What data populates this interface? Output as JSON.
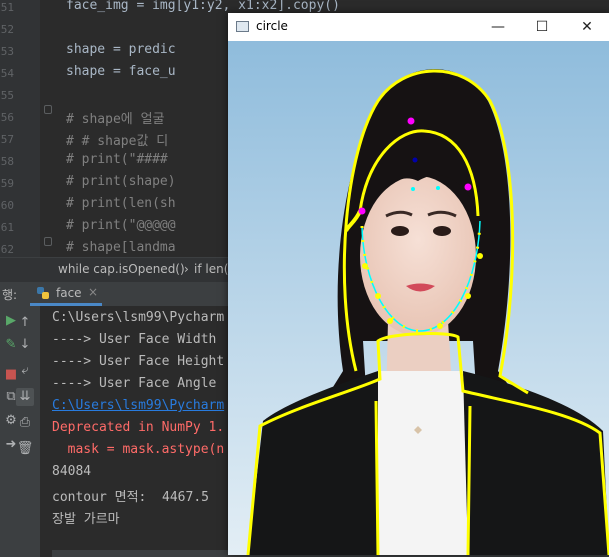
{
  "editor": {
    "line_numbers": [
      "51",
      "52",
      "53",
      "54",
      "55",
      "56",
      "57",
      "58",
      "59",
      "60",
      "61",
      "62"
    ],
    "lines": [
      {
        "text": "face_img = img[y1:y2, x1:x2].copy()",
        "comment": false
      },
      {
        "text": "",
        "comment": false
      },
      {
        "text": "shape = predic",
        "comment": false
      },
      {
        "text": "shape = face_u",
        "comment": false
      },
      {
        "text": "",
        "comment": false
      },
      {
        "text": "# shape에 얼굴",
        "comment": true
      },
      {
        "text": "# # shape값 디",
        "comment": true
      },
      {
        "text": "# print(\"####",
        "comment": true
      },
      {
        "text": "# print(shape)",
        "comment": true
      },
      {
        "text": "# print(len(sh",
        "comment": true
      },
      {
        "text": "# print(\"@@@@@",
        "comment": true
      },
      {
        "text": "# shape[landma",
        "comment": true
      }
    ]
  },
  "breadcrumb": {
    "item1": "while cap.isOpened()",
    "separator": "›",
    "item2": "if len("
  },
  "run_panel": {
    "label": "행:",
    "tab_name": "face",
    "close_glyph": "×"
  },
  "console": {
    "lines": [
      {
        "text": "C:\\Users\\lsm99\\Pycharm",
        "color": "#bbbbbb"
      },
      {
        "text": "----> User Face Width",
        "color": "#bbbbbb"
      },
      {
        "text": "----> User Face Height",
        "color": "#bbbbbb"
      },
      {
        "text": "----> User Face Angle",
        "color": "#bbbbbb"
      },
      {
        "text": "C:\\Users\\lsm99\\Pycharm",
        "color": "#287bde"
      },
      {
        "text": "Deprecated in NumPy 1.",
        "color": "#ff6b68"
      },
      {
        "text": "  mask = mask.astype(n",
        "color": "#ff6b68"
      },
      {
        "text": "84084",
        "color": "#bbbbbb"
      },
      {
        "text": "contour 면적:  4467.5",
        "color": "#bbbbbb"
      },
      {
        "text": "장발 가르마",
        "color": "#bbbbbb"
      }
    ]
  },
  "window": {
    "title": "circle",
    "minimize": "—",
    "maximize": "☐",
    "close": "✕"
  },
  "colors": {
    "contour": "#ffff00",
    "landmark_magenta": "#ff00ff",
    "landmark_cyan": "#00ffff",
    "center_dot": "#0000aa"
  }
}
